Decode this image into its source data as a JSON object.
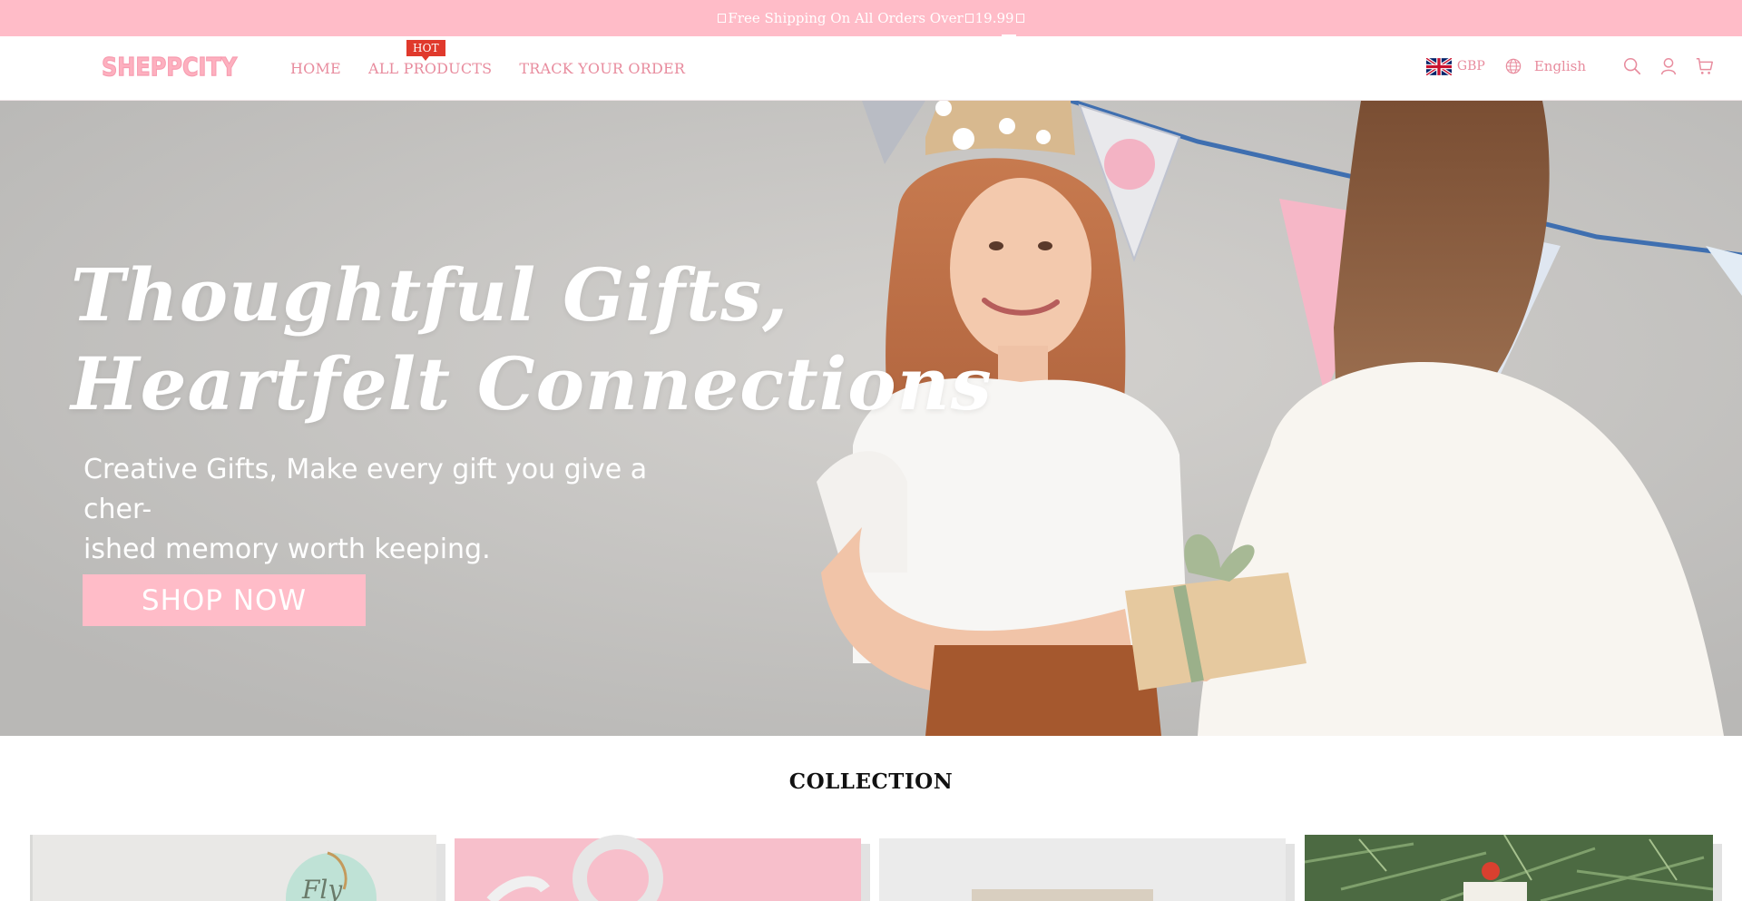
{
  "announcement": {
    "text_before": "Free Shipping On All Orders Over ",
    "amount": "19.99"
  },
  "header": {
    "logo": "SHEPPCITY",
    "nav": [
      {
        "label": "HOME"
      },
      {
        "label": "ALL PRODUCTS",
        "badge": "HOT"
      },
      {
        "label": "TRACK YOUR ORDER"
      }
    ],
    "currency": "GBP",
    "language": "English"
  },
  "hero": {
    "title_line1": "Thoughtful Gifts,",
    "title_line2": "Heartfelt Connections",
    "subtitle_line1": "Creative Gifts, Make every gift you give a cher-",
    "subtitle_line2": "ished memory worth keeping.",
    "cta": "SHOP NOW"
  },
  "collection": {
    "title": "COLLECTION",
    "cards": [
      {
        "name": "collection-card-1",
        "color": "#e9e8e6"
      },
      {
        "name": "collection-card-2",
        "color": "#f7bfcb"
      },
      {
        "name": "collection-card-3",
        "color": "#ebebeb"
      },
      {
        "name": "collection-card-4",
        "color": "#3f5a3a"
      }
    ]
  },
  "colors": {
    "pink": "#ffbcc8",
    "nav_text": "#e88c9e",
    "hot_badge": "#e0392c"
  }
}
